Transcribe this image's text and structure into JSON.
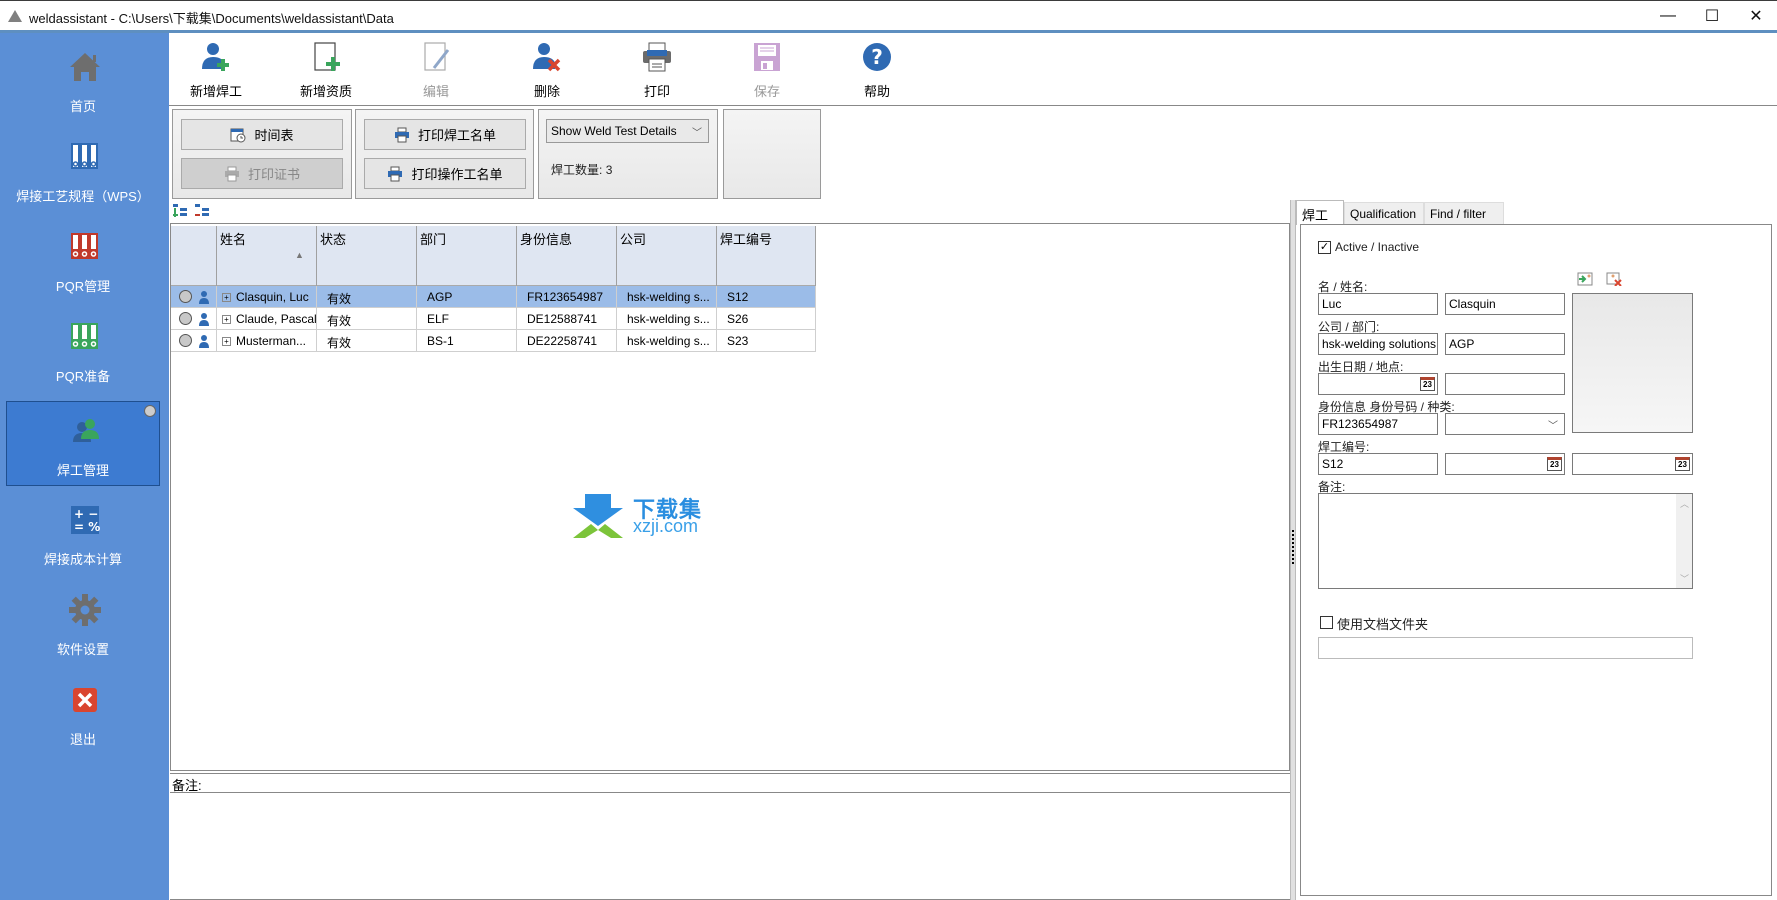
{
  "window": {
    "title": "weldassistant - C:\\Users\\下载集\\Documents\\weldassistant\\Data",
    "controls": {
      "minimize": "—",
      "maximize": "☐",
      "close": "✕"
    }
  },
  "sidebar": {
    "items": [
      {
        "label": "首页",
        "icon": "home-icon"
      },
      {
        "label": "焊接工艺规程（WPS）",
        "icon": "binder-blue-icon"
      },
      {
        "label": "PQR管理",
        "icon": "binder-red-icon"
      },
      {
        "label": "PQR准备",
        "icon": "binder-green-icon"
      },
      {
        "label": "焊工管理",
        "icon": "welders-icon",
        "active": true
      },
      {
        "label": "焊接成本计算",
        "icon": "calculator-icon"
      },
      {
        "label": "软件设置",
        "icon": "gear-icon"
      },
      {
        "label": "退出",
        "icon": "exit-icon"
      }
    ]
  },
  "toolbar": {
    "items": [
      {
        "label": "新增焊工",
        "icon": "add-welder-icon",
        "enabled": true
      },
      {
        "label": "新增资质",
        "icon": "add-document-icon",
        "enabled": true
      },
      {
        "label": "编辑",
        "icon": "edit-icon",
        "enabled": false
      },
      {
        "label": "删除",
        "icon": "delete-welder-icon",
        "enabled": true
      },
      {
        "label": "打印",
        "icon": "printer-icon",
        "enabled": true
      },
      {
        "label": "保存",
        "icon": "save-icon",
        "enabled": false
      },
      {
        "label": "帮助",
        "icon": "help-icon",
        "enabled": true
      }
    ]
  },
  "actions": {
    "schedule": "时间表",
    "print_certificate": "打印证书",
    "print_welder_list": "打印焊工名单",
    "print_operator_list": "打印操作工名单",
    "view_select": "Show Weld Test Details",
    "welder_count_label": "焊工数量:",
    "welder_count": "3"
  },
  "grid": {
    "columns": [
      "姓名",
      "状态",
      "部门",
      "身份信息",
      "公司",
      "焊工编号"
    ],
    "sort_column": "姓名",
    "rows": [
      {
        "name": "Clasquin, Luc",
        "status": "有效",
        "dept": "AGP",
        "id": "FR123654987",
        "company": "hsk-welding s...",
        "welder_no": "S12",
        "selected": true
      },
      {
        "name": "Claude, Pascal",
        "status": "有效",
        "dept": "ELF",
        "id": "DE12588741",
        "company": "hsk-welding s...",
        "welder_no": "S26",
        "selected": false
      },
      {
        "name": "Musterman...",
        "status": "有效",
        "dept": "BS-1",
        "id": "DE22258741",
        "company": "hsk-welding s...",
        "welder_no": "S23",
        "selected": false
      }
    ]
  },
  "notes_label": "备注:",
  "watermark": {
    "cn": "下载集",
    "en": "xzji.com"
  },
  "detail": {
    "tabs": [
      "焊工",
      "Qualification",
      "Find / filter"
    ],
    "active_tab": "焊工",
    "active_checkbox_label": "Active / Inactive",
    "active_checked": true,
    "name_label": "名 / 姓名:",
    "first_name": "Luc",
    "last_name": "Clasquin",
    "company_label": "公司 / 部门:",
    "company": "hsk-welding solutions",
    "department": "AGP",
    "birth_label": "出生日期 / 地点:",
    "birth_date": "",
    "birth_place": "",
    "id_label": "身份信息 身份号码 / 种类:",
    "id_number": "FR123654987",
    "id_type": "",
    "welder_no_label": "焊工编号:",
    "welder_no": "S12",
    "date1": "",
    "date2": "",
    "remarks_label": "备注:",
    "remarks": "",
    "use_folder_label": "使用文档文件夹",
    "use_folder_checked": false,
    "folder_path": "",
    "calendar_day": "23"
  }
}
